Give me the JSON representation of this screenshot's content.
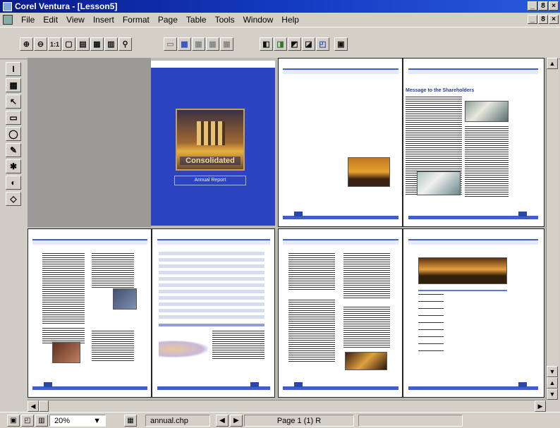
{
  "window": {
    "title": "Corel Ventura - [Lesson5]"
  },
  "window_buttons": [
    "_",
    "8",
    "×"
  ],
  "menu": [
    "File",
    "Edit",
    "View",
    "Insert",
    "Format",
    "Page",
    "Table",
    "Tools",
    "Window",
    "Help"
  ],
  "toolbar": {
    "zoom_in_icon": "zoom-in",
    "zoom_out_icon": "zoom-out",
    "actual_size_label": "1:1",
    "buttons": [
      "full-page-icon",
      "facing-pages-icon",
      "thumbnail-icon",
      "zoom-window-icon",
      "frame-view-icon",
      "table-view-icon",
      "grid-icon",
      "layout-icon",
      "master-icon",
      "frame-1-icon",
      "frame-2-icon",
      "frame-3-icon",
      "frame-4-icon",
      "preview-icon",
      "calculator-icon"
    ]
  },
  "left_tools": [
    "text-cursor-tool",
    "frame-tool",
    "pointer-tool",
    "rectangle-tool",
    "ellipse-tool",
    "pen-tool",
    "paint-tool",
    "fill-tool",
    "bucket-tool"
  ],
  "document": {
    "cover_logo_text": "Consolidated",
    "cover_subtitle": "Annual Report",
    "page2_heading": "Message to the Shareholders"
  },
  "statusbar": {
    "zoom": "20%",
    "filename": "annual.chp",
    "page": "Page 1 (1)  R"
  },
  "colors": {
    "accent": "#3c5fc8",
    "title_bar": "#0a1a8c",
    "cover": "#2c44c0"
  }
}
